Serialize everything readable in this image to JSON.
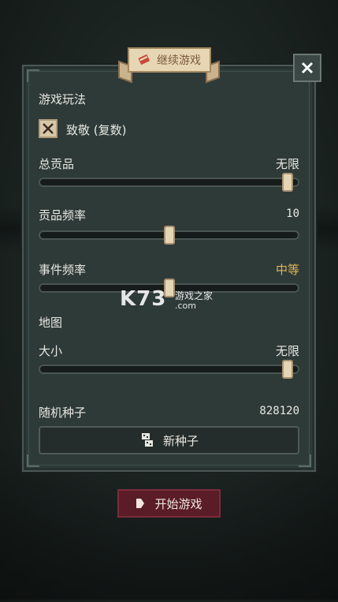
{
  "banner": {
    "title": "继续游戏",
    "icon": "scroll-icon"
  },
  "close": {
    "icon": "close-icon"
  },
  "gameplay": {
    "section_title": "游戏玩法",
    "option_label": "致敬 (复数)",
    "option_checked": true
  },
  "settings": [
    {
      "label": "总贡品",
      "value": "无限",
      "level": 0.96
    },
    {
      "label": "贡品频率",
      "value": "10",
      "level": 0.5
    },
    {
      "label": "事件频率",
      "value": "中等",
      "level": 0.5
    }
  ],
  "map": {
    "section_title": "地图",
    "size_label": "大小",
    "size_value": "无限",
    "size_level": 0.96
  },
  "seed": {
    "label": "随机种子",
    "value": "828120",
    "new_seed_label": "新种子"
  },
  "start": {
    "label": "开始游戏"
  },
  "watermark": {
    "brand": "K73",
    "site": "游戏之家",
    "domain": ".com"
  },
  "colors": {
    "accent": "#e0b45a",
    "start_button": "#5a1c26",
    "panel": "#2e3a38",
    "thumb": "#e5d5b5"
  }
}
